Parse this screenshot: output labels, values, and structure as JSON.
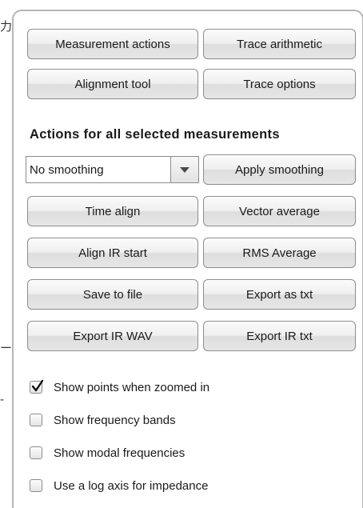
{
  "stray_glyphs": [
    "力",
    "ー",
    "-"
  ],
  "panel": {
    "top_buttons": {
      "measurement_actions": "Measurement actions",
      "trace_arithmetic": "Trace arithmetic",
      "alignment_tool": "Alignment tool",
      "trace_options": "Trace options"
    },
    "section_heading": "Actions for all selected measurements",
    "smoothing_select": {
      "value": "No smoothing",
      "icon": "chevron-down-icon"
    },
    "action_buttons": {
      "apply_smoothing": "Apply smoothing",
      "time_align": "Time align",
      "vector_average": "Vector average",
      "align_ir_start": "Align IR start",
      "rms_average": "RMS Average",
      "save_to_file": "Save to file",
      "export_as_txt": "Export as txt",
      "export_ir_wav": "Export IR WAV",
      "export_ir_txt": "Export IR txt"
    },
    "checkboxes": [
      {
        "label": "Show points when zoomed in",
        "checked": true
      },
      {
        "label": "Show frequency bands",
        "checked": false
      },
      {
        "label": "Show modal frequencies",
        "checked": false
      },
      {
        "label": "Use a log axis for impedance",
        "checked": false
      }
    ]
  }
}
